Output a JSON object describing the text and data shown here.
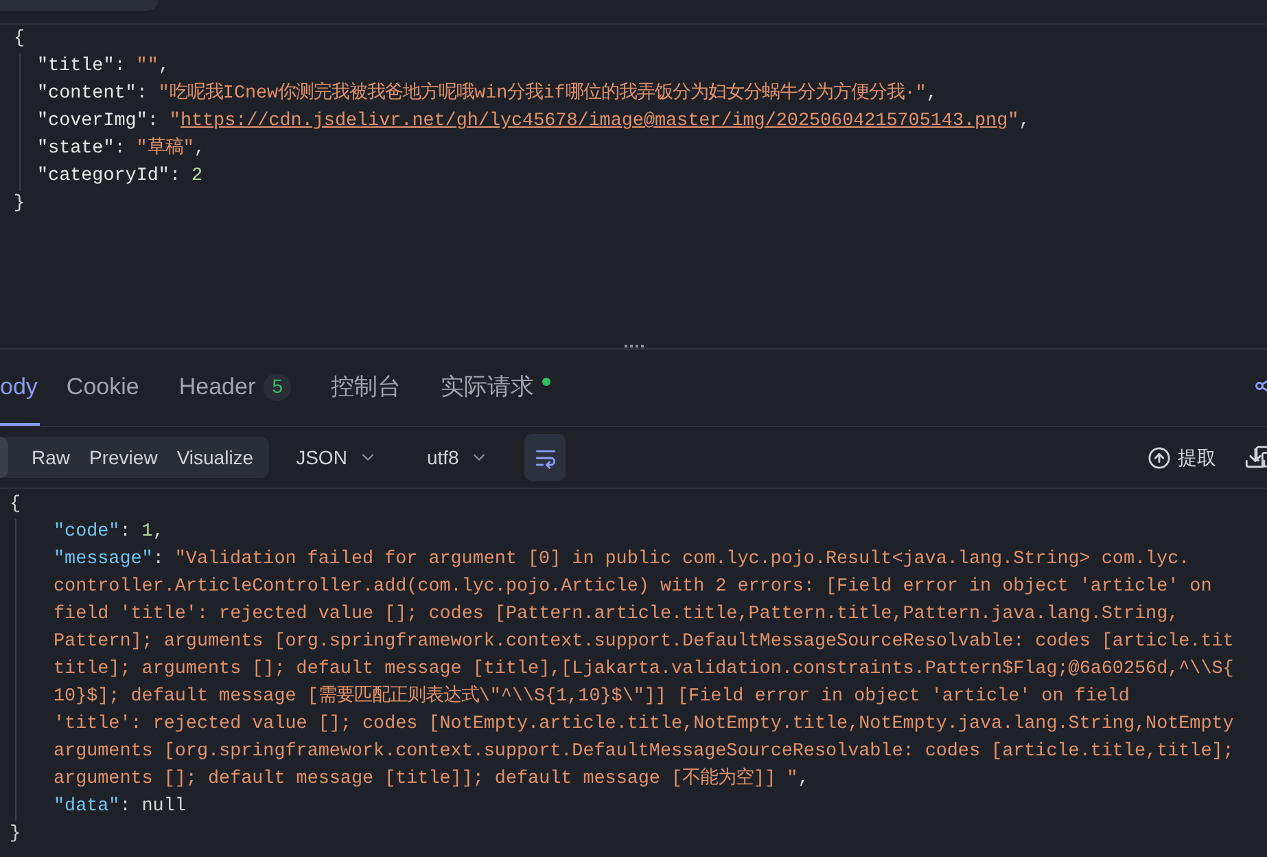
{
  "request_body": {
    "lines": [
      {
        "kind": "brace",
        "text": "{"
      },
      {
        "kind": "string",
        "key": "\"title\"",
        "sep": ":",
        "value": "\"\"",
        "trail": ","
      },
      {
        "kind": "string",
        "key": "\"content\"",
        "sep": ":",
        "value": "\"吃呢我ICnew你测完我被我爸地方呢哦win分我if哪位的我弄饭分为妇女分蜗牛分为方便分我·\"",
        "trail": ","
      },
      {
        "kind": "link",
        "key": "\"coverImg\"",
        "sep": ":",
        "quote": "\"",
        "value": "https://cdn.jsdelivr.net/gh/lyc45678/image@master/img/20250604215705143.png",
        "trail": ","
      },
      {
        "kind": "string",
        "key": "\"state\"",
        "sep": ":",
        "value": "\"草稿\"",
        "trail": ","
      },
      {
        "kind": "number",
        "key": "\"categoryId\"",
        "sep": ":",
        "value": "2"
      },
      {
        "kind": "brace",
        "text": "}"
      }
    ]
  },
  "response_tabs": [
    {
      "label": "ody",
      "selected": true
    },
    {
      "label": "Cookie",
      "selected": false
    },
    {
      "label": "Header",
      "badge": "5",
      "selected": false
    },
    {
      "label": "控制台",
      "selected": false
    },
    {
      "label": "实际请求",
      "dot": true,
      "selected": false
    }
  ],
  "view_modes": [
    {
      "label": "Raw",
      "selected": false
    },
    {
      "label": "Preview",
      "selected": false
    },
    {
      "label": "Visualize",
      "selected": false
    }
  ],
  "format_dropdown": "JSON",
  "encoding_dropdown": "utf8",
  "wrap_on": true,
  "extract_button": "提取",
  "response_body": {
    "lines": [
      {
        "kind": "brace",
        "text": "{"
      },
      {
        "kind": "number",
        "key": "\"code\"",
        "sep": ":",
        "value": "1",
        "trail": ","
      },
      {
        "kind": "string",
        "key": "\"message\"",
        "sep": ":",
        "value": "\"Validation failed for argument [0] in public com.lyc.pojo.Result<java.lang.String> com.lyc."
      },
      {
        "kind": "cont",
        "text": "controller.ArticleController.add(com.lyc.pojo.Article) with 2 errors: [Field error in object 'article' on"
      },
      {
        "kind": "cont",
        "text": "field 'title': rejected value []; codes [Pattern.article.title,Pattern.title,Pattern.java.lang.String,"
      },
      {
        "kind": "cont",
        "text": "Pattern]; arguments [org.springframework.context.support.DefaultMessageSourceResolvable: codes [article.tit"
      },
      {
        "kind": "cont",
        "text": "title]; arguments []; default message [title],[Ljakarta.validation.constraints.Pattern$Flag;@6a60256d,^\\\\S{"
      },
      {
        "kind": "cont",
        "text": "10}$]; default message [需要匹配正则表达式\\\"^\\\\S{1,10}$\\\"]] [Field error in object 'article' on field"
      },
      {
        "kind": "cont",
        "text": "'title': rejected value []; codes [NotEmpty.article.title,NotEmpty.title,NotEmpty.java.lang.String,NotEmpty"
      },
      {
        "kind": "cont",
        "text": "arguments [org.springframework.context.support.DefaultMessageSourceResolvable: codes [article.title,title];"
      },
      {
        "kind": "cont",
        "text": "arguments []; default message [title]]; default message [不能为空]] \"",
        "trail": ","
      },
      {
        "kind": "null",
        "key": "\"data\"",
        "sep": ":",
        "value": "null"
      },
      {
        "kind": "brace",
        "text": "}"
      }
    ]
  }
}
